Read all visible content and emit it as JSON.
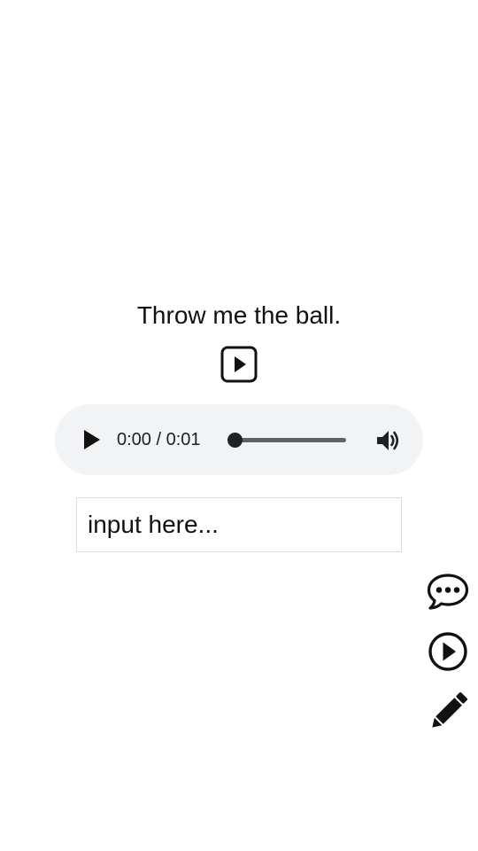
{
  "sentence": {
    "text": "Throw me the ball."
  },
  "audio": {
    "current_time": "0:00",
    "duration": "0:01",
    "time_display": "0:00 / 0:01",
    "progress": 0
  },
  "answer": {
    "placeholder": "input here...",
    "value": ""
  },
  "side_actions": [
    {
      "icon": "speech-bubble-icon"
    },
    {
      "icon": "play-circle-icon"
    },
    {
      "icon": "pencil-icon"
    }
  ],
  "colors": {
    "text": "#111111",
    "player_background": "#f1f3f4",
    "player_controls": "#202124",
    "input_border": "#dcdcdc"
  }
}
